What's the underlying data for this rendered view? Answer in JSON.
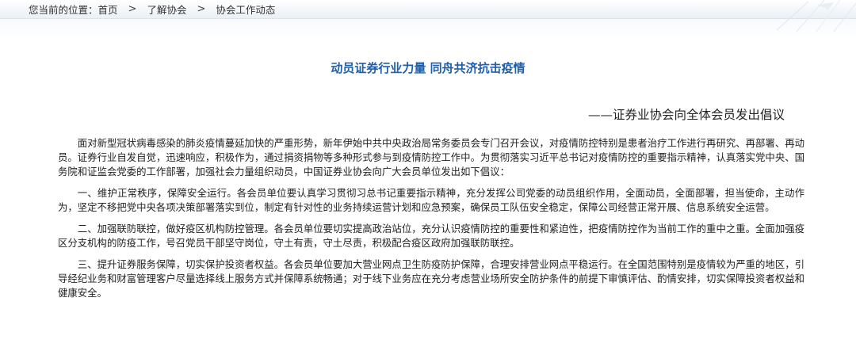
{
  "breadcrumb": {
    "prefix": "您当前的位置：",
    "home": "首页",
    "separator": ">",
    "section": "了解协会",
    "current": "协会工作动态"
  },
  "article": {
    "title": "动员证券行业力量 同舟共济抗击疫情",
    "subtitle": "——证券业协会向全体会员发出倡议",
    "paragraphs": [
      "面对新型冠状病毒感染的肺炎疫情蔓延加快的严重形势，新年伊始中共中央政治局常务委员会专门召开会议，对疫情防控特别是患者治疗工作进行再研究、再部署、再动员。证券行业自发自觉，迅速响应，积极作为，通过捐资捐物等多种形式参与到疫情防控工作中。为贯彻落实习近平总书记对疫情防控的重要指示精神，认真落实党中央、国务院和证监会党委的工作部署，加强社会力量组织动员，中国证券业协会向广大会员单位发出如下倡议：",
      "一、维护正常秩序，保障安全运行。各会员单位要认真学习贯彻习总书记重要指示精神，充分发挥公司党委的动员组织作用，全面动员，全面部署，担当使命，主动作为，坚定不移把党中央各项决策部署落实到位，制定有针对性的业务持续运营计划和应急预案，确保员工队伍安全稳定，保障公司经营正常开展、信息系统安全运营。",
      "二、加强联防联控，做好疫区机构防控管理。各会员单位要切实提高政治站位，充分认识疫情防控的重要性和紧迫性，把疫情防控作为当前工作的重中之重。全面加强疫区分支机构的防疫工作，号召党员干部坚守岗位，守土有责，守土尽责，积极配合疫区政府加强联防联控。",
      "三、提升证券服务保障，切实保护投资者权益。各会员单位要加大营业网点卫生防疫防护保障，合理安排营业网点平稳运行。在全国范围特别是疫情较为严重的地区，引导经纪业务和财富管理客户尽量选择线上服务方式并保障系统畅通；对于线下业务应在充分考虑营业场所安全防护条件的前提下审慎评估、酌情安排，切实保障投资者权益和健康安全。"
    ]
  },
  "colors": {
    "title": "#1f5fa8",
    "text": "#222222",
    "breadcrumb_bg": "#eaf0f6"
  }
}
